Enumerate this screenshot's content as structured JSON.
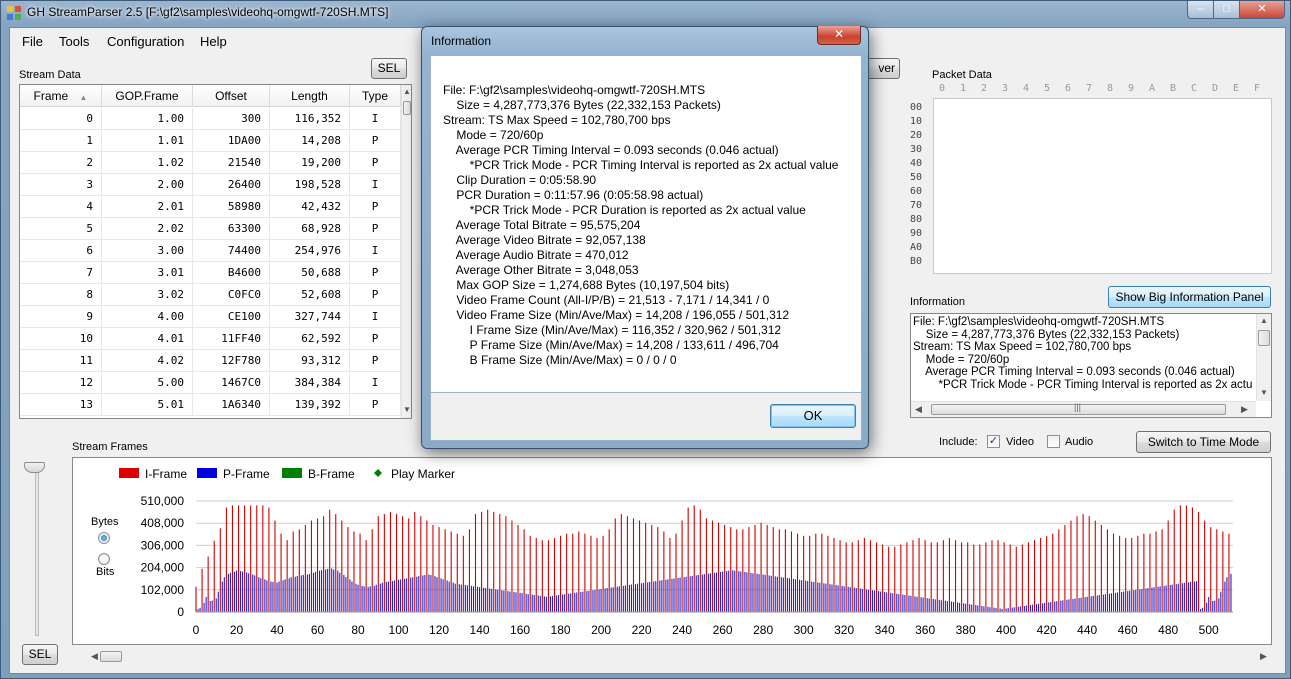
{
  "window": {
    "title": "GH StreamParser 2.5 [F:\\gf2\\samples\\videohq-omgwtf-720SH.MTS]",
    "minimize": "–",
    "maximize": "□",
    "close": "✕"
  },
  "menu": [
    "File",
    "Tools",
    "Configuration",
    "Help"
  ],
  "stream_data": {
    "label": "Stream Data",
    "sel_button": "SEL",
    "columns": [
      "Frame",
      "GOP.Frame",
      "Offset",
      "Length",
      "Type"
    ],
    "rows": [
      [
        "0",
        "1.00",
        "300",
        "116,352",
        "I"
      ],
      [
        "1",
        "1.01",
        "1DA00",
        "14,208",
        "P"
      ],
      [
        "2",
        "1.02",
        "21540",
        "19,200",
        "P"
      ],
      [
        "3",
        "2.00",
        "26400",
        "198,528",
        "I"
      ],
      [
        "4",
        "2.01",
        "58980",
        "42,432",
        "P"
      ],
      [
        "5",
        "2.02",
        "63300",
        "68,928",
        "P"
      ],
      [
        "6",
        "3.00",
        "74400",
        "254,976",
        "I"
      ],
      [
        "7",
        "3.01",
        "B4600",
        "50,688",
        "P"
      ],
      [
        "8",
        "3.02",
        "C0FC0",
        "52,608",
        "P"
      ],
      [
        "9",
        "4.00",
        "CE100",
        "327,744",
        "I"
      ],
      [
        "10",
        "4.01",
        "11FF40",
        "62,592",
        "P"
      ],
      [
        "11",
        "4.02",
        "12F780",
        "93,312",
        "P"
      ],
      [
        "12",
        "5.00",
        "1467C0",
        "384,384",
        "I"
      ],
      [
        "13",
        "5.01",
        "1A6340",
        "139,392",
        "P"
      ]
    ]
  },
  "hidden_button_fragment": "ver",
  "packet_data": {
    "label": "Packet Data",
    "columns": [
      "0",
      "1",
      "2",
      "3",
      "4",
      "5",
      "6",
      "7",
      "8",
      "9",
      "A",
      "B",
      "C",
      "D",
      "E",
      "F"
    ],
    "rows": [
      "00",
      "10",
      "20",
      "30",
      "40",
      "50",
      "60",
      "70",
      "80",
      "90",
      "A0",
      "B0"
    ]
  },
  "information": {
    "label": "Information",
    "show_big_button": "Show Big Information Panel",
    "lines": [
      "File: F:\\gf2\\samples\\videohq-omgwtf-720SH.MTS",
      "    Size = 4,287,773,376 Bytes (22,332,153 Packets)",
      "Stream: TS Max Speed = 102,780,700 bps",
      "    Mode = 720/60p",
      "    Average PCR Timing Interval = 0.093 seconds (0.046 actual)",
      "        *PCR Trick Mode - PCR Timing Interval is reported as 2x actual value"
    ]
  },
  "include": {
    "label": "Include:",
    "video_label": "Video",
    "video_checked": true,
    "audio_label": "Audio",
    "audio_checked": false,
    "switch_button": "Switch to Time Mode",
    "check_mark": "✓"
  },
  "stream_frames": {
    "label": "Stream Frames",
    "sel_button": "SEL",
    "bytes_label": "Bytes",
    "bits_label": "Bits",
    "selected_unit": "Bytes"
  },
  "chart_data": {
    "type": "bar",
    "legend": [
      {
        "name": "I-Frame",
        "color": "#e00000"
      },
      {
        "name": "P-Frame",
        "color": "#0000e0"
      },
      {
        "name": "B-Frame",
        "color": "#008000"
      },
      {
        "name": "Play Marker",
        "color": "#008000"
      }
    ],
    "y_ticks": [
      "510,000",
      "408,000",
      "306,000",
      "204,000",
      "102,000",
      "0"
    ],
    "ylim": [
      0,
      510000
    ],
    "x_ticks": [
      "0",
      "20",
      "40",
      "60",
      "80",
      "100",
      "120",
      "140",
      "160",
      "180",
      "200",
      "220",
      "240",
      "260",
      "280",
      "300",
      "320",
      "340",
      "360",
      "380",
      "400",
      "420",
      "440",
      "460",
      "480",
      "500"
    ],
    "xlim": [
      0,
      512
    ],
    "gop_length": 3,
    "i_frames": [
      116352,
      198528,
      254976,
      327744,
      384384,
      480000,
      490000,
      490000,
      490000,
      490000,
      490000,
      490000,
      480000,
      420000,
      360000,
      330000,
      370000,
      380000,
      400000,
      420000,
      430000,
      440000,
      470000,
      450000,
      420000,
      390000,
      370000,
      360000,
      330000,
      380000,
      440000,
      450000,
      460000,
      450000,
      440000,
      430000,
      460000,
      440000,
      420000,
      400000,
      390000,
      380000,
      370000,
      360000,
      350000,
      380000,
      450000,
      460000,
      470000,
      460000,
      450000,
      440000,
      420000,
      400000,
      380000,
      350000,
      340000,
      330000,
      330000,
      340000,
      350000,
      360000,
      360000,
      370000,
      360000,
      350000,
      340000,
      350000,
      380000,
      430000,
      450000,
      440000,
      430000,
      420000,
      410000,
      400000,
      390000,
      370000,
      340000,
      360000,
      420000,
      480000,
      490000,
      470000,
      430000,
      420000,
      410000,
      400000,
      390000,
      380000,
      380000,
      390000,
      400000,
      410000,
      400000,
      390000,
      380000,
      380000,
      370000,
      360000,
      350000,
      350000,
      360000,
      360000,
      350000,
      340000,
      330000,
      320000,
      320000,
      330000,
      340000,
      330000,
      320000,
      310000,
      300000,
      300000,
      310000,
      320000,
      330000,
      340000,
      330000,
      320000,
      320000,
      330000,
      340000,
      330000,
      320000,
      320000,
      310000,
      310000,
      320000,
      330000,
      330000,
      320000,
      310000,
      300000,
      310000,
      320000,
      330000,
      340000,
      350000,
      360000,
      380000,
      400000,
      420000,
      440000,
      450000,
      440000,
      420000,
      400000,
      380000,
      360000,
      350000,
      340000,
      340000,
      350000,
      360000,
      360000,
      370000,
      380000,
      420000,
      470000,
      490000,
      490000,
      480000,
      460000,
      420000,
      390000,
      380000,
      370000,
      360000,
      350000,
      340000,
      330000,
      320000
    ],
    "p_frames": [
      14208,
      19200,
      42432,
      68928,
      50688,
      52608,
      62592,
      93312,
      139392,
      160000,
      175000,
      180000,
      185000,
      190000,
      188000,
      186000,
      182000,
      178000,
      172000,
      168000,
      160000,
      155000,
      150000,
      145000,
      140000,
      138000,
      135000,
      140000,
      146000,
      150000,
      155000,
      160000,
      162000,
      165000,
      168000,
      170000,
      172000,
      175000,
      180000,
      185000,
      190000,
      192000,
      195000,
      198000,
      200000,
      195000,
      190000,
      180000,
      170000,
      160000,
      150000,
      140000,
      130000,
      125000,
      120000,
      118000,
      115000,
      118000,
      120000,
      125000,
      130000,
      135000,
      138000,
      140000,
      142000,
      145000,
      148000,
      150000,
      152000,
      155000,
      158000,
      160000,
      162000,
      165000,
      168000,
      170000,
      172000,
      170000,
      165000,
      160000,
      155000,
      150000,
      145000,
      140000,
      135000,
      130000,
      128000,
      126000,
      124000,
      122000,
      120000,
      118000,
      116000,
      114000,
      112000,
      110000,
      108000,
      106000,
      104000,
      102000,
      100000,
      98000,
      96000,
      94000,
      92000,
      90000,
      88000,
      86000,
      84000,
      82000,
      80000,
      78000,
      76000,
      74000,
      72000,
      70000,
      72000,
      74000,
      76000,
      78000,
      80000,
      82000,
      84000,
      86000,
      88000,
      90000,
      92000,
      94000,
      96000,
      98000,
      100000,
      102000,
      104000,
      106000,
      108000,
      110000,
      112000,
      114000,
      116000,
      118000,
      120000,
      122000,
      124000,
      126000,
      128000,
      130000,
      132000,
      134000,
      136000,
      138000,
      140000,
      142000,
      144000,
      146000,
      148000,
      150000,
      152000,
      154000,
      156000,
      158000,
      160000,
      162000,
      164000,
      166000,
      168000,
      170000,
      172000,
      174000,
      176000,
      178000,
      180000,
      182000,
      184000,
      186000,
      188000,
      190000,
      192000,
      190000,
      188000,
      186000,
      184000,
      182000,
      180000,
      178000,
      176000,
      174000,
      172000,
      170000,
      168000,
      166000,
      164000,
      162000,
      160000,
      158000,
      156000,
      154000,
      152000,
      150000,
      148000,
      146000,
      144000,
      142000,
      140000,
      138000,
      136000,
      134000,
      132000,
      130000,
      128000,
      126000,
      124000,
      122000,
      120000,
      118000,
      116000,
      114000,
      112000,
      110000,
      108000,
      106000,
      104000,
      102000,
      100000,
      98000,
      96000,
      94000,
      92000,
      90000,
      88000,
      86000,
      84000,
      82000,
      80000,
      78000,
      76000,
      74000,
      72000,
      70000,
      68000,
      66000,
      64000,
      62000,
      60000,
      58000,
      56000,
      54000,
      52000,
      50000,
      48000,
      46000,
      44000,
      42000,
      40000,
      38000,
      36000,
      34000,
      32000,
      30000,
      28000,
      26000,
      24000,
      22000,
      20000,
      18000,
      16000,
      14208,
      16000,
      18000,
      20000,
      22000,
      24000,
      26000,
      28000,
      30000,
      32000,
      34000,
      36000,
      38000,
      40000,
      42000,
      44000,
      46000,
      48000,
      50000,
      52000,
      54000,
      56000,
      58000,
      60000,
      62000,
      64000,
      66000,
      68000,
      70000,
      72000,
      74000,
      76000,
      78000,
      80000,
      82000,
      84000,
      86000,
      88000,
      90000,
      92000,
      94000,
      96000,
      98000,
      100000,
      102000,
      104000,
      106000,
      108000,
      110000,
      112000,
      114000,
      116000,
      118000,
      120000,
      122000,
      124000,
      126000,
      128000,
      130000,
      132000,
      134000,
      136000,
      138000,
      140000,
      142000
    ]
  },
  "dialog": {
    "title": "Information",
    "close": "✕",
    "ok_button": "OK",
    "lines": [
      "File: F:\\gf2\\samples\\videohq-omgwtf-720SH.MTS",
      "    Size = 4,287,773,376 Bytes (22,332,153 Packets)",
      "Stream: TS Max Speed = 102,780,700 bps",
      "    Mode = 720/60p",
      "    Average PCR Timing Interval = 0.093 seconds (0.046 actual)",
      "        *PCR Trick Mode - PCR Timing Interval is reported as 2x actual value",
      "    Clip Duration = 0:05:58.90",
      "    PCR Duration = 0:11:57.96 (0:05:58.98 actual)",
      "        *PCR Trick Mode - PCR Duration is reported as 2x actual value",
      "    Average Total Bitrate = 95,575,204",
      "    Average Video Bitrate = 92,057,138",
      "    Average Audio Bitrate = 470,012",
      "    Average Other Bitrate = 3,048,053",
      "    Max GOP Size = 1,274,688 Bytes (10,197,504 bits)",
      "    Video Frame Count (All-I/P/B) = 21,513 - 7,171 / 14,341 / 0",
      "    Video Frame Size (Min/Ave/Max) = 14,208 / 196,055 / 501,312",
      "        I Frame Size (Min/Ave/Max) = 116,352 / 320,962 / 501,312",
      "        P Frame Size (Min/Ave/Max) = 14,208 / 133,611 / 496,704",
      "        B Frame Size (Min/Ave/Max) = 0 / 0 / 0"
    ]
  }
}
